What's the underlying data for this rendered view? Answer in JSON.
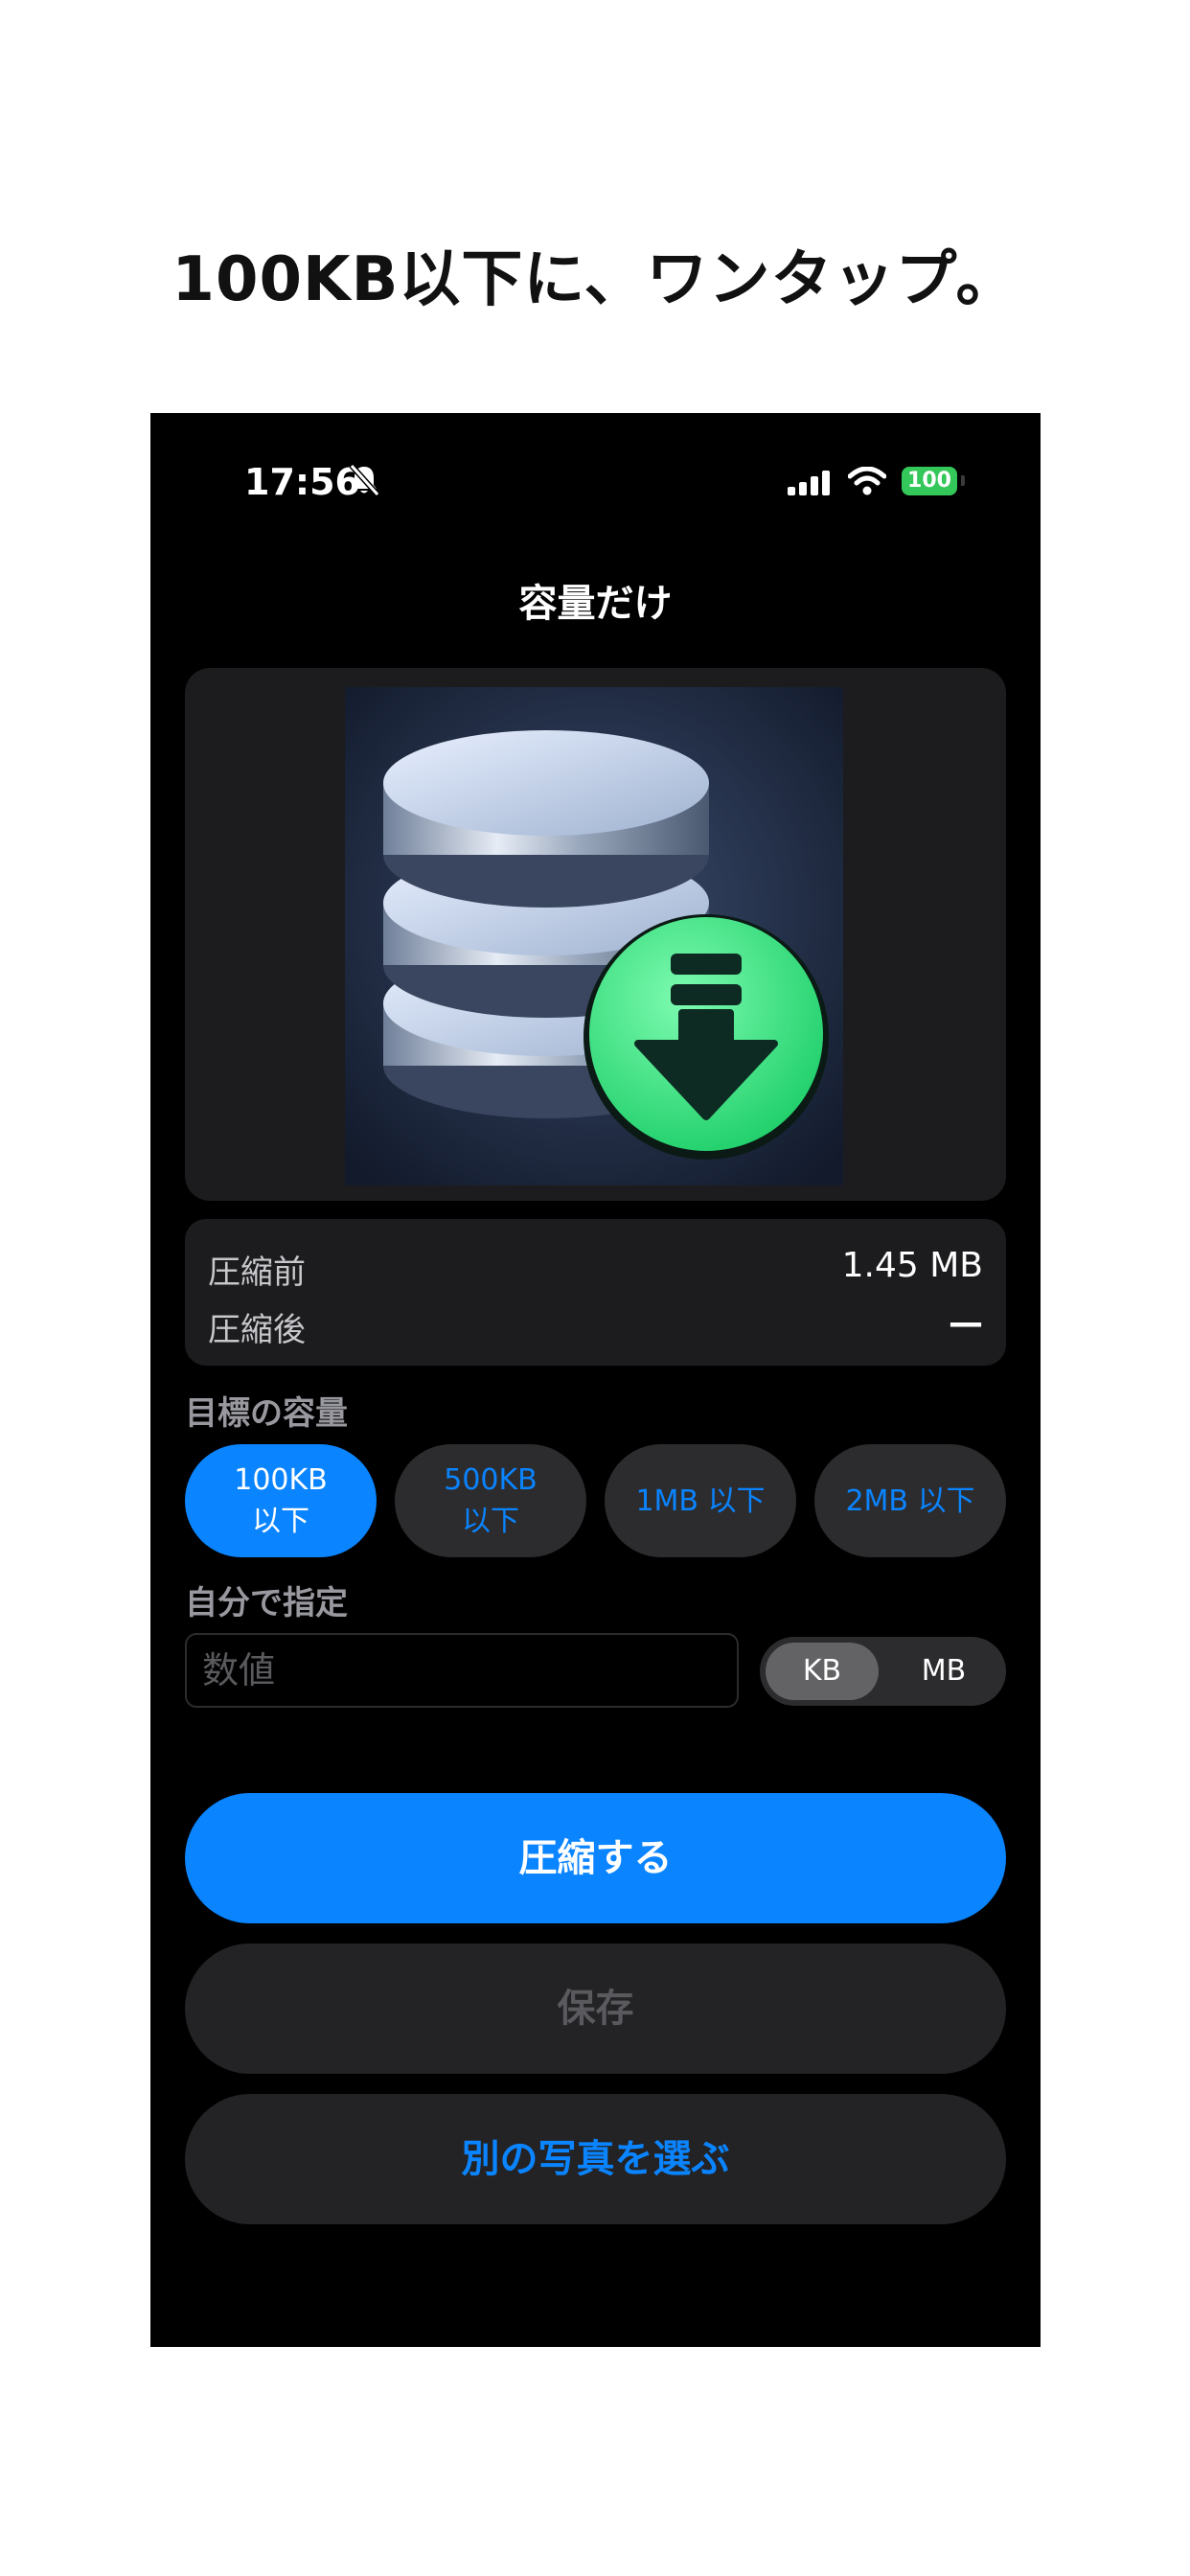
{
  "headline": "100KB以下に、ワンタップ。",
  "status_bar": {
    "time": "17:56",
    "battery": "100"
  },
  "nav": {
    "title": "容量だけ"
  },
  "preview": {
    "image": "database-download-icon"
  },
  "sizes": {
    "before_label": "圧縮前",
    "before_value": "1.45 MB",
    "after_label": "圧縮後",
    "after_value": "—"
  },
  "target": {
    "label": "目標の容量",
    "options": [
      {
        "label": "100KB\n以下",
        "selected": true
      },
      {
        "label": "500KB\n以下",
        "selected": false
      },
      {
        "label": "1MB 以下",
        "selected": false
      },
      {
        "label": "2MB 以下",
        "selected": false
      }
    ]
  },
  "custom": {
    "label": "自分で指定",
    "placeholder": "数値",
    "units": [
      "KB",
      "MB"
    ],
    "selected_unit": "KB"
  },
  "buttons": {
    "compress": "圧縮する",
    "save": "保存",
    "choose_other": "別の写真を選ぶ"
  },
  "colors": {
    "accent": "#0a84ff",
    "card": "#1c1c1e",
    "chip": "#2c2c2e",
    "battery": "#34c759",
    "download_badge": "#2ee07a"
  }
}
